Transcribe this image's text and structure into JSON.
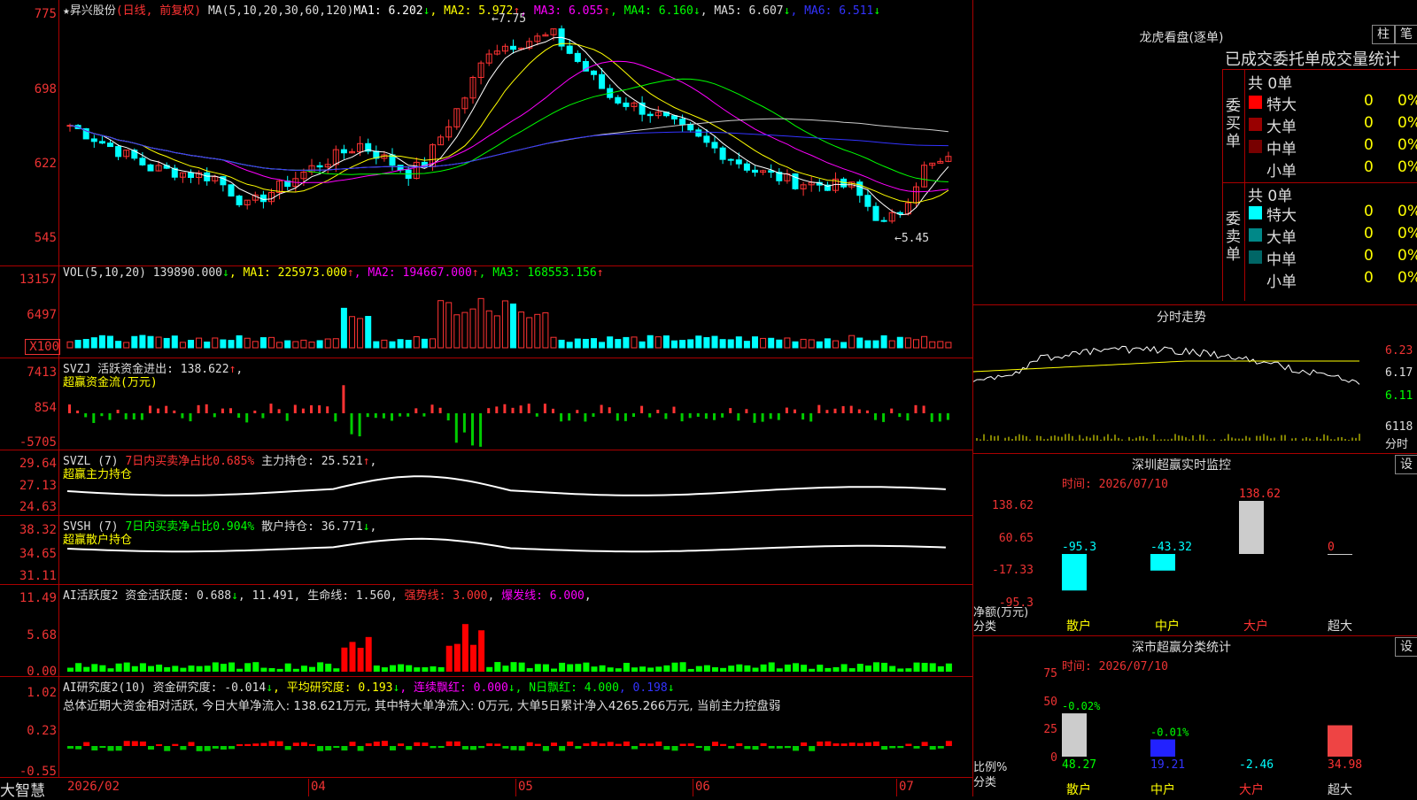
{
  "stock": {
    "header_name": "★昇兴股份",
    "header_type": "(日线, 前复权)",
    "ma_labels": [
      {
        "text": "MA(5,10,20,30,60,120)",
        "color": "#ddd"
      },
      {
        "text": "MA1: 6.202",
        "color": "#fff"
      },
      {
        "text": "↓",
        "color": "#0f0"
      },
      {
        "text": ", MA2: 5.972",
        "color": "#ff0"
      },
      {
        "text": "↑",
        "color": "#f33"
      },
      {
        "text": ", MA3: 6.055",
        "color": "#f0f"
      },
      {
        "text": "↑",
        "color": "#f33"
      },
      {
        "text": ", MA4: 6.160",
        "color": "#0f0"
      },
      {
        "text": "↓",
        "color": "#0f0"
      },
      {
        "text": ", MA5: 6.607",
        "color": "#ddd"
      },
      {
        "text": "↓",
        "color": "#0f0"
      },
      {
        "text": ", MA6: 6.511",
        "color": "#33f"
      },
      {
        "text": "↓",
        "color": "#0f0"
      }
    ],
    "price_axis": [
      "775",
      "698",
      "622",
      "545"
    ],
    "high_label": "7.75",
    "low_label": "5.45"
  },
  "volume": {
    "title": [
      {
        "text": "VOL(5,10,20) 139890.000",
        "color": "#ddd"
      },
      {
        "text": "↓",
        "color": "#0f0"
      },
      {
        "text": ", MA1: 225973.000",
        "color": "#ff0"
      },
      {
        "text": "↑",
        "color": "#f33"
      },
      {
        "text": ", MA2: 194667.000",
        "color": "#f0f"
      },
      {
        "text": "↑",
        "color": "#f33"
      },
      {
        "text": ", MA3: 168553.156",
        "color": "#0f0"
      },
      {
        "text": "↑",
        "color": "#f33"
      }
    ],
    "axis": [
      "13157",
      "6497",
      "X100"
    ]
  },
  "svzj": {
    "title1": [
      {
        "text": "SVZJ  活跃资金进出: 138.622",
        "color": "#ddd"
      },
      {
        "text": "↑",
        "color": "#f33"
      },
      {
        "text": ",",
        "color": "#ddd"
      }
    ],
    "title2": "超赢资金流(万元)",
    "axis": [
      "7413",
      "854",
      "-5705"
    ]
  },
  "svzl": {
    "title1": [
      {
        "text": "SVZL (7) ",
        "color": "#ddd"
      },
      {
        "text": "7日内买卖净占比0.685%",
        "color": "#f33"
      },
      {
        "text": " 主力持仓: 25.521",
        "color": "#ddd"
      },
      {
        "text": "↑",
        "color": "#f33"
      },
      {
        "text": ",",
        "color": "#ddd"
      }
    ],
    "title2": "超赢主力持仓",
    "axis": [
      "29.64",
      "27.13",
      "24.63"
    ]
  },
  "svsh": {
    "title1": [
      {
        "text": "SVSH (7) ",
        "color": "#ddd"
      },
      {
        "text": "7日内买卖净占比0.904%",
        "color": "#0f0"
      },
      {
        "text": " 散户持仓: 36.771",
        "color": "#ddd"
      },
      {
        "text": "↓",
        "color": "#0f0"
      },
      {
        "text": ",",
        "color": "#ddd"
      }
    ],
    "title2": "超赢散户持仓",
    "axis": [
      "38.32",
      "34.65",
      "31.11"
    ]
  },
  "ai_active": {
    "title": [
      {
        "text": "AI活跃度2 资金活跃度: 0.688",
        "color": "#ddd"
      },
      {
        "text": "↓",
        "color": "#0f0"
      },
      {
        "text": ", 11.491, 生命线: 1.560, ",
        "color": "#ddd"
      },
      {
        "text": "强势线: 3.000",
        "color": "#f33"
      },
      {
        "text": ", ",
        "color": "#ddd"
      },
      {
        "text": "爆发线: 6.000",
        "color": "#f0f"
      },
      {
        "text": ",",
        "color": "#ddd"
      }
    ],
    "axis": [
      "11.49",
      "5.68",
      "0.00"
    ]
  },
  "ai_research": {
    "title": [
      {
        "text": "AI研究度2(10) 资金研究度: -0.014",
        "color": "#ddd"
      },
      {
        "text": "↓",
        "color": "#0f0"
      },
      {
        "text": ", 平均研究度: 0.193",
        "color": "#ff0"
      },
      {
        "text": "↓",
        "color": "#0f0"
      },
      {
        "text": ", 连续飘红: 0.000",
        "color": "#f0f"
      },
      {
        "text": "↓",
        "color": "#0f0"
      },
      {
        "text": ", N日飘红: 4.000",
        "color": "#0f0"
      },
      {
        "text": ", 0.198",
        "color": "#33f"
      },
      {
        "text": "↓",
        "color": "#0f0"
      }
    ],
    "summary": "总体近期大资金相对活跃, 今日大单净流入: 138.621万元, 其中特大单净流入: 0万元, 大单5日累计净入4265.266万元, 当前主力控盘弱",
    "axis": [
      "1.02",
      "0.23",
      "-0.55"
    ]
  },
  "date_axis": {
    "brand": "大智慧",
    "labels": [
      "2026/02",
      "04",
      "05",
      "06",
      "07"
    ]
  },
  "dragon": {
    "title": "龙虎看盘(逐单)",
    "btn_bar": "柱",
    "btn_pen": "笔",
    "tabs": "已成交委托单成交量统计",
    "buy": {
      "side_label": "委买单",
      "total": "共 0单",
      "rows": [
        {
          "name": "特大",
          "count": "0",
          "pct": "0%",
          "color": "#f00"
        },
        {
          "name": "大单",
          "count": "0",
          "pct": "0%",
          "color": "#900"
        },
        {
          "name": "中单",
          "count": "0",
          "pct": "0%",
          "color": "#700"
        },
        {
          "name": "小单",
          "count": "0",
          "pct": "0%",
          "color": "#000"
        }
      ]
    },
    "sell": {
      "side_label": "委卖单",
      "total": "共 0单",
      "rows": [
        {
          "name": "特大",
          "count": "0",
          "pct": "0%",
          "color": "#0ff"
        },
        {
          "name": "大单",
          "count": "0",
          "pct": "0%",
          "color": "#088"
        },
        {
          "name": "中单",
          "count": "0",
          "pct": "0%",
          "color": "#066"
        },
        {
          "name": "小单",
          "count": "0",
          "pct": "0%",
          "color": "#000"
        }
      ]
    }
  },
  "intraday": {
    "title": "分时走势",
    "axis_right": [
      "6.23",
      "6.17",
      "6.11"
    ],
    "vol_label": "6118",
    "vol_unit": "分时"
  },
  "sz_monitor": {
    "title": "深圳超赢实时监控",
    "settings": "设",
    "time": "时间: 2026/07/10",
    "axis": [
      "138.62",
      "60.65",
      "-17.33",
      "-95.3"
    ],
    "unit": "净额(万元)",
    "cat_label": "分类",
    "categories": [
      "散户",
      "中户",
      "大户",
      "超大"
    ],
    "values": [
      -95.3,
      -43.32,
      138.62,
      0
    ],
    "value_labels": [
      "-95.3",
      "-43.32",
      "138.62",
      "0"
    ]
  },
  "sz_class": {
    "title": "深市超赢分类统计",
    "settings": "设",
    "time": "时间: 2026/07/10",
    "axis": [
      "75",
      "50",
      "25",
      "0"
    ],
    "unit": "比例%",
    "cat_label": "分类",
    "categories": [
      "散户",
      "中户",
      "大户",
      "超大"
    ],
    "top_labels": [
      "-0.02%",
      "-0.01%",
      "",
      ""
    ],
    "bottom_labels": [
      "48.27",
      "19.21",
      "-2.46",
      "34.98"
    ],
    "values": [
      48.27,
      19.21,
      -2.46,
      34.98
    ]
  },
  "chart_data": {
    "type": "bar",
    "title": "深圳超赢实时监控",
    "categories": [
      "散户",
      "中户",
      "大户",
      "超大"
    ],
    "series": [
      {
        "name": "净额(万元)",
        "values": [
          -95.3,
          -43.32,
          138.62,
          0
        ]
      },
      {
        "name": "比例%",
        "values": [
          48.27,
          19.21,
          -2.46,
          34.98
        ]
      }
    ]
  }
}
